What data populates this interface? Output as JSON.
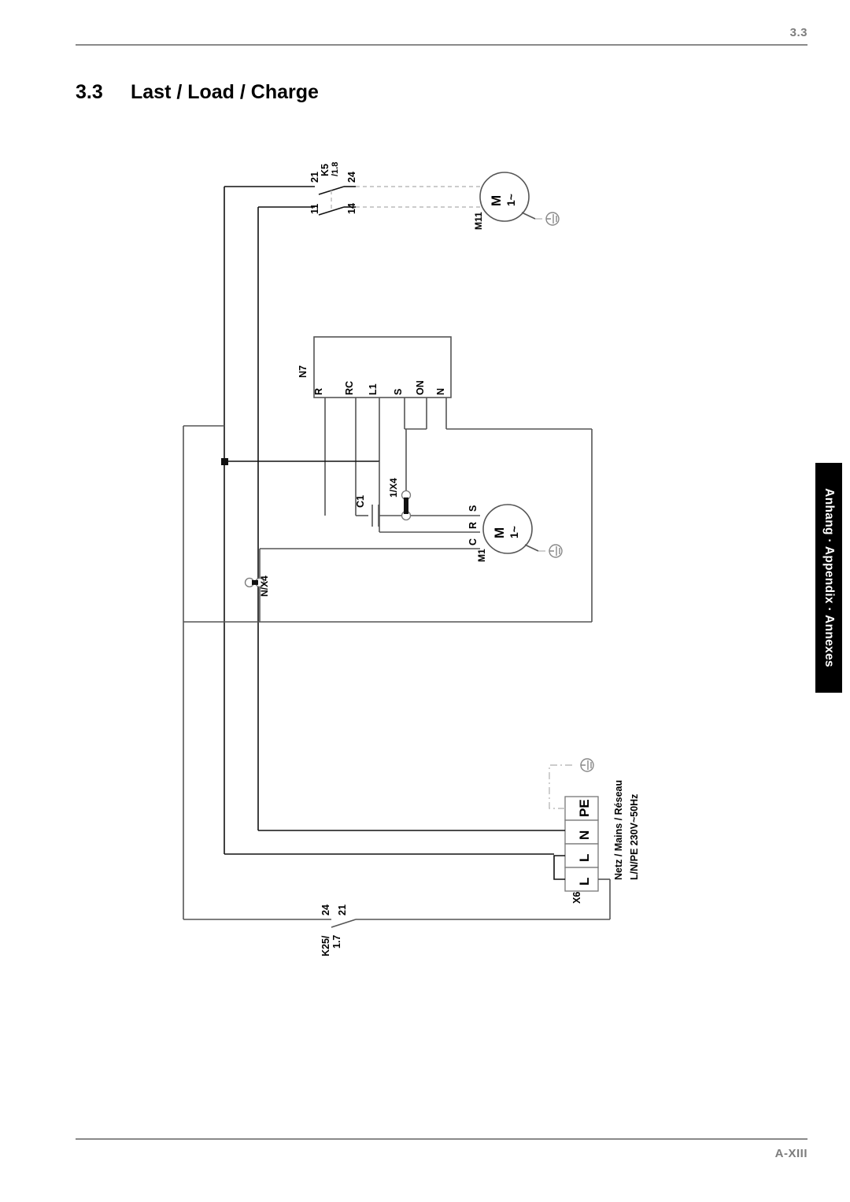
{
  "header": {
    "page_marker": "3.3"
  },
  "title": {
    "number": "3.3",
    "text": "Last / Load / Charge"
  },
  "footer": {
    "page_number": "A-XIII"
  },
  "side_tab": {
    "label": "Anhang · Appendix · Annexes"
  },
  "diagram": {
    "type": "electrical-wiring-schematic",
    "components": {
      "k5_relay": {
        "designation": "K5",
        "cross_reference": "/1.8",
        "terminals": {
          "in_top": "21",
          "in_bottom": "11",
          "out_top": "24",
          "out_bottom": "14"
        }
      },
      "motor_m11": {
        "designation": "M11",
        "symbol_letter": "M",
        "symbol_phase": "1~"
      },
      "module_n7": {
        "designation": "N7",
        "terminals": [
          "R",
          "RC",
          "L1",
          "S",
          "ON",
          "N"
        ]
      },
      "capacitor_c1": {
        "designation": "C1"
      },
      "terminal_1x4": {
        "designation": "1/X4"
      },
      "terminal_nx4": {
        "designation": "N/X4"
      },
      "motor_m1": {
        "designation": "M1",
        "symbol_letter": "M",
        "symbol_phase": "1~",
        "terminals": [
          "S",
          "R",
          "C"
        ]
      },
      "mains_terminal_x6": {
        "designation": "X6",
        "terminals": [
          "PE",
          "N",
          "L",
          "L"
        ],
        "caption_line1": "Netz / Mains / Réseau",
        "caption_line2": "L/N/PE 230V~50Hz"
      },
      "k25_relay": {
        "designation": "K25/",
        "cross_reference": "1.7",
        "terminals": {
          "left": "24",
          "right": "21"
        }
      }
    }
  },
  "colors": {
    "rule": "#8a8a8a",
    "page_no": "#7d7d7d",
    "wire": "#555555",
    "wire_dark": "#111111",
    "tab_bg": "#000000",
    "tab_fg": "#ffffff"
  }
}
